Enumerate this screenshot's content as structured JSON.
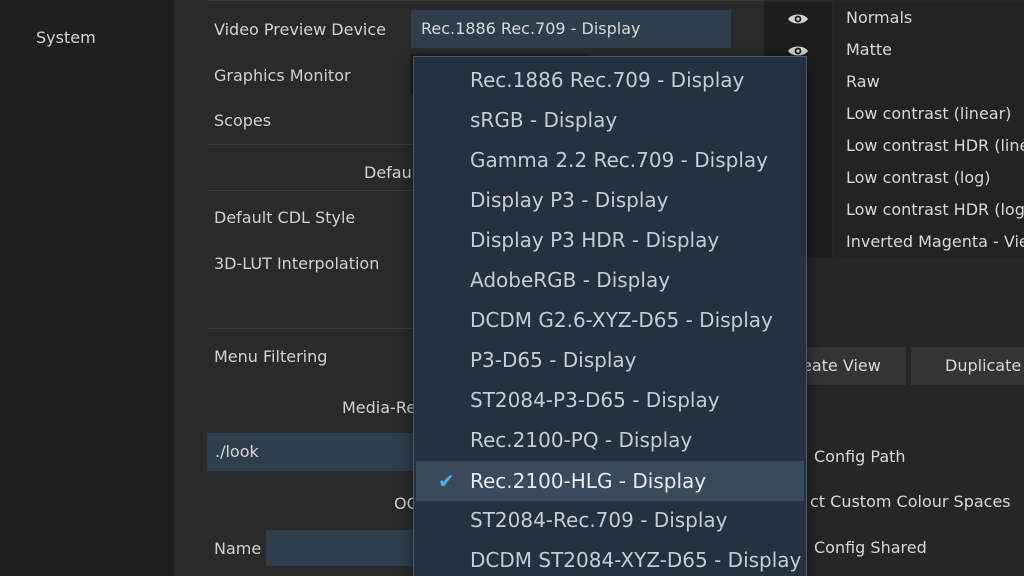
{
  "nav": {
    "items": [
      "System"
    ]
  },
  "settings": {
    "video_preview_label": "Video Preview Device",
    "video_preview_value": "Rec.1886 Rec.709 - Display",
    "graphics_monitor_label": "Graphics Monitor",
    "scopes_label": "Scopes",
    "defaults_header": "Defaul",
    "default_cdl_label": "Default CDL Style",
    "lut_label": "3D-LUT Interpolation",
    "menu_filtering_label": "Menu Filtering",
    "media_header": "Media-Re",
    "look_path": "./look",
    "oc_header": "OC",
    "name_label": "Name"
  },
  "views": [
    {
      "name": "Normals"
    },
    {
      "name": "Matte"
    },
    {
      "name": "Raw"
    },
    {
      "name": "Low contrast (linear)"
    },
    {
      "name": "Low contrast HDR (linear)"
    },
    {
      "name": "Low contrast (log)"
    },
    {
      "name": "Low contrast HDR (log)"
    },
    {
      "name": "Inverted Magenta - View"
    }
  ],
  "buttons": {
    "create_view": "eate View",
    "duplicate": "Duplicate"
  },
  "right_text": {
    "config_path": "Config Path",
    "custom_colour_spaces": "ct Custom Colour Spaces",
    "config_shared": "Config Shared"
  },
  "dropdown": {
    "selected": "Rec.2100-HLG - Display",
    "options": [
      "Rec.1886 Rec.709 - Display",
      "sRGB - Display",
      "Gamma 2.2 Rec.709 - Display",
      "Display P3 - Display",
      "Display P3 HDR - Display",
      "AdobeRGB - Display",
      "DCDM G2.6-XYZ-D65 - Display",
      "P3-D65 - Display",
      "ST2084-P3-D65 - Display",
      "Rec.2100-PQ - Display",
      "Rec.2100-HLG - Display",
      "ST2084-Rec.709 - Display",
      "DCDM ST2084-XYZ-D65 - Display"
    ]
  },
  "colors": {
    "accent": "#4fb0e6",
    "field": "#2f3e4d",
    "menu_bg": "#233140"
  }
}
